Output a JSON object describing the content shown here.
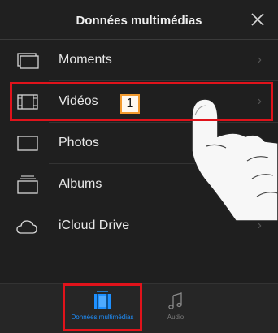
{
  "header": {
    "title": "Données multimédias",
    "close_icon": "close-icon"
  },
  "list": {
    "items": [
      {
        "label": "Moments",
        "icon": "moments-icon",
        "chevron": "›"
      },
      {
        "label": "Vidéos",
        "icon": "film-icon",
        "chevron": "›"
      },
      {
        "label": "Photos",
        "icon": "photo-frame-icon",
        "chevron": "›"
      },
      {
        "label": "Albums",
        "icon": "albums-icon",
        "chevron": ""
      },
      {
        "label": "iCloud Drive",
        "icon": "cloud-icon",
        "chevron": "›"
      }
    ]
  },
  "annotation": {
    "step_number": "1",
    "highlight_color": "#e0131b",
    "badge_border_color": "#f29a2e"
  },
  "tabbar": {
    "tabs": [
      {
        "label": "Données multimédias",
        "icon": "media-library-icon",
        "active": true
      },
      {
        "label": "Audio",
        "icon": "music-note-icon",
        "active": false
      }
    ]
  },
  "colors": {
    "background": "#1f1f1f",
    "text": "#e8e8e8",
    "active_tab": "#1e90ff",
    "inactive_tab": "#7a7a7a"
  }
}
